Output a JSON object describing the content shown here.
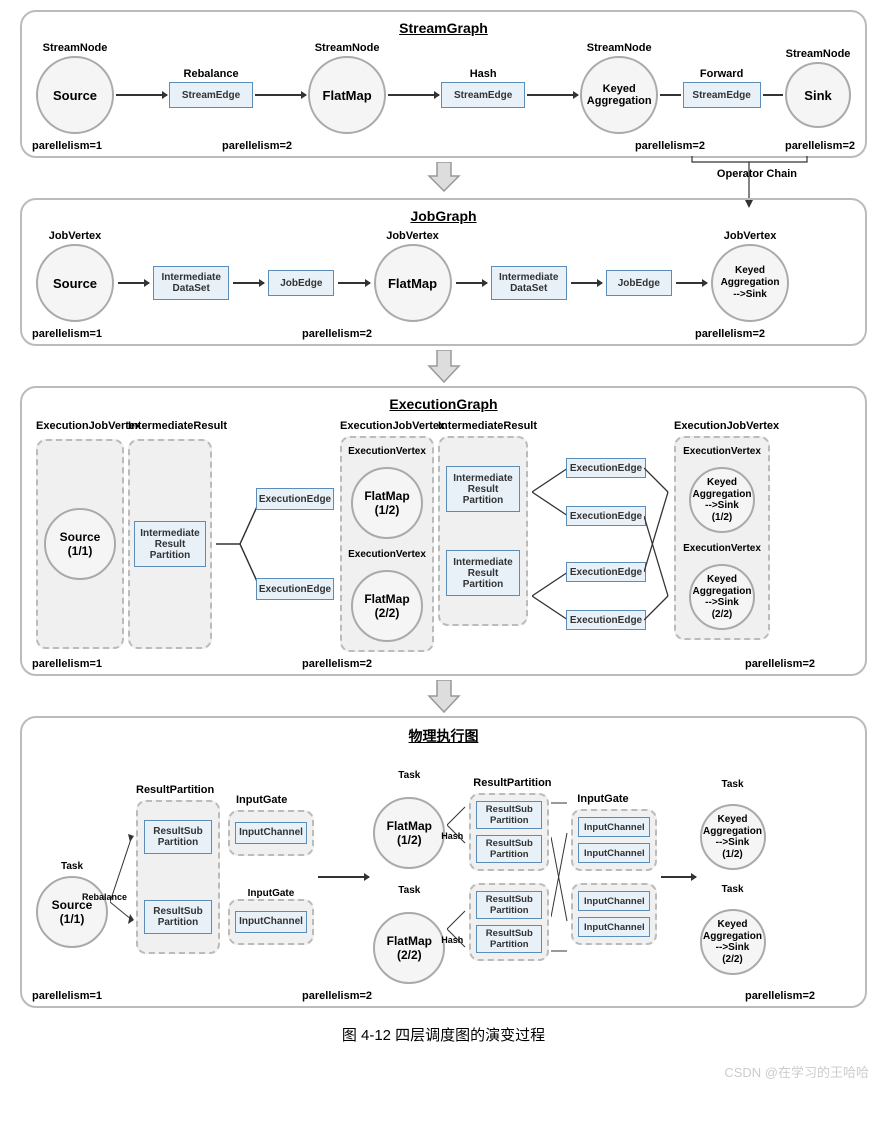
{
  "streamGraph": {
    "title": "StreamGraph",
    "nodeLabel": "StreamNode",
    "nodes": {
      "source": "Source",
      "flatmap": "FlatMap",
      "keyed": "Keyed\nAggregation",
      "sink": "Sink"
    },
    "edgeBox": "StreamEdge",
    "edgeLabels": {
      "rebalance": "Rebalance",
      "hash": "Hash",
      "forward": "Forward"
    },
    "parallel": {
      "p1": "parellelism=1",
      "p2": "parellelism=2"
    },
    "opChain": "Operator Chain"
  },
  "jobGraph": {
    "title": "JobGraph",
    "vertexLabel": "JobVertex",
    "nodes": {
      "source": "Source",
      "flatmap": "FlatMap",
      "keyedSink": "Keyed\nAggregation\n-->Sink"
    },
    "boxes": {
      "ids": "Intermediate\nDataSet",
      "jobEdge": "JobEdge"
    },
    "parallel": {
      "p1": "parellelism=1",
      "p2": "parellelism=2"
    }
  },
  "execGraph": {
    "title": "ExecutionGraph",
    "labels": {
      "ejv": "ExecutionJobVertex",
      "ir": "IntermediateResult",
      "ev": "ExecutionVertex"
    },
    "nodes": {
      "source": "Source\n(1/1)",
      "fm1": "FlatMap\n(1/2)",
      "fm2": "FlatMap\n(2/2)",
      "ks1": "Keyed\nAggregation\n-->Sink\n(1/2)",
      "ks2": "Keyed\nAggregation\n-->Sink\n(2/2)"
    },
    "boxes": {
      "irp": "Intermediate\nResult\nPartition",
      "ee": "ExecutionEdge"
    },
    "parallel": {
      "p1": "parellelism=1",
      "p2": "parellelism=2"
    }
  },
  "physGraph": {
    "title": "物理执行图",
    "labels": {
      "task": "Task",
      "rp": "ResultPartition",
      "ig": "InputGate"
    },
    "nodes": {
      "source": "Source\n(1/1)",
      "fm1": "FlatMap\n(1/2)",
      "fm2": "FlatMap\n(2/2)",
      "ks1": "Keyed\nAggregation\n-->Sink\n(1/2)",
      "ks2": "Keyed\nAggregation\n-->Sink\n(2/2)"
    },
    "boxes": {
      "rsp": "ResultSub\nPartition",
      "ic": "InputChannel"
    },
    "edgeLabels": {
      "rebalance": "Rebalance",
      "hash": "Hash"
    },
    "parallel": {
      "p1": "parellelism=1",
      "p2": "parellelism=2"
    }
  },
  "caption": "图 4-12  四层调度图的演变过程",
  "watermark": "CSDN @在学习的王哈哈"
}
